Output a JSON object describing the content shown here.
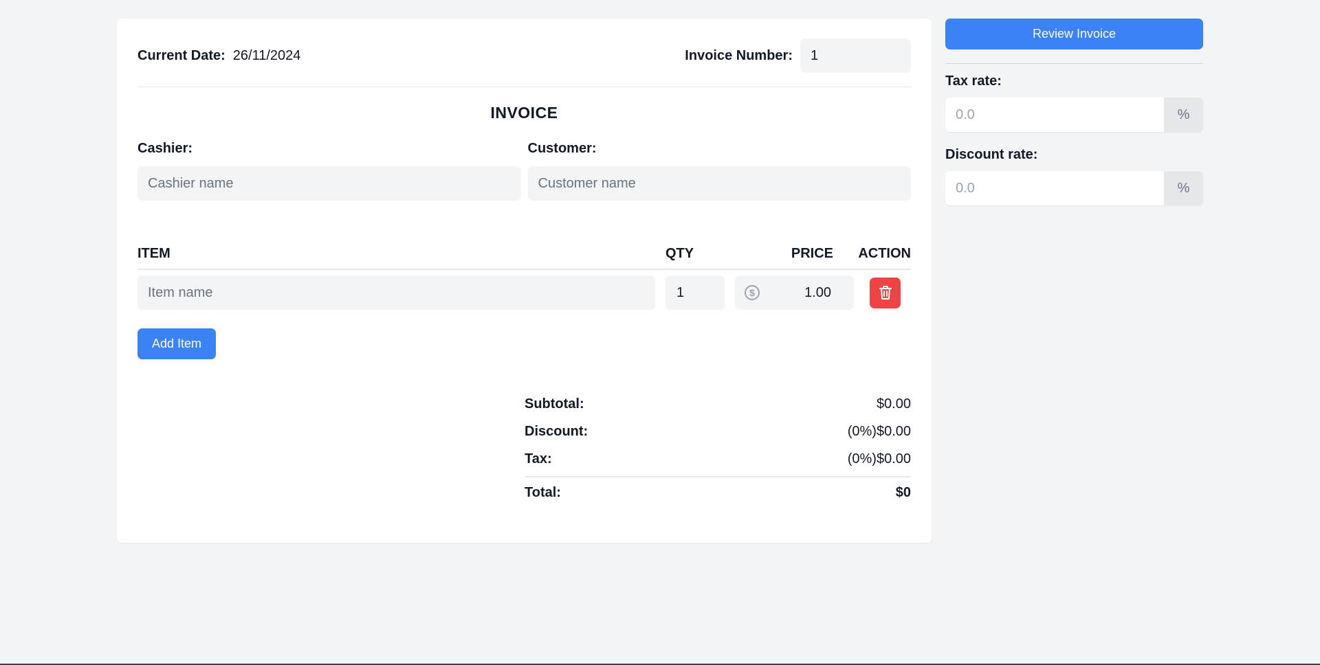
{
  "invoice": {
    "current_date_label": "Current Date:",
    "current_date_value": "26/11/2024",
    "invoice_number_label": "Invoice Number:",
    "invoice_number_value": "1",
    "title": "INVOICE",
    "cashier_label": "Cashier:",
    "cashier_placeholder": "Cashier name",
    "customer_label": "Customer:",
    "customer_placeholder": "Customer name"
  },
  "items": {
    "headers": {
      "item": "ITEM",
      "qty": "QTY",
      "price": "PRICE",
      "action": "ACTION"
    },
    "rows": [
      {
        "item_placeholder": "Item name",
        "qty": "1",
        "price": "1.00"
      }
    ],
    "add_button_label": "Add Item"
  },
  "totals": {
    "subtotal_label": "Subtotal:",
    "subtotal_value": "$0.00",
    "discount_label": "Discount:",
    "discount_value": "(0%)$0.00",
    "tax_label": "Tax:",
    "tax_value": "(0%)$0.00",
    "total_label": "Total:",
    "total_value": "$0"
  },
  "sidebar": {
    "review_button_label": "Review Invoice",
    "tax_rate_label": "Tax rate:",
    "tax_rate_placeholder": "0.0",
    "tax_rate_suffix": "%",
    "discount_rate_label": "Discount rate:",
    "discount_rate_placeholder": "0.0",
    "discount_rate_suffix": "%"
  },
  "icons": {
    "price_prefix": "dollar-circle-icon",
    "delete": "trash-icon"
  },
  "colors": {
    "primary": "#3b82f6",
    "danger": "#ef4444",
    "background": "#f3f4f6",
    "card": "#ffffff"
  }
}
